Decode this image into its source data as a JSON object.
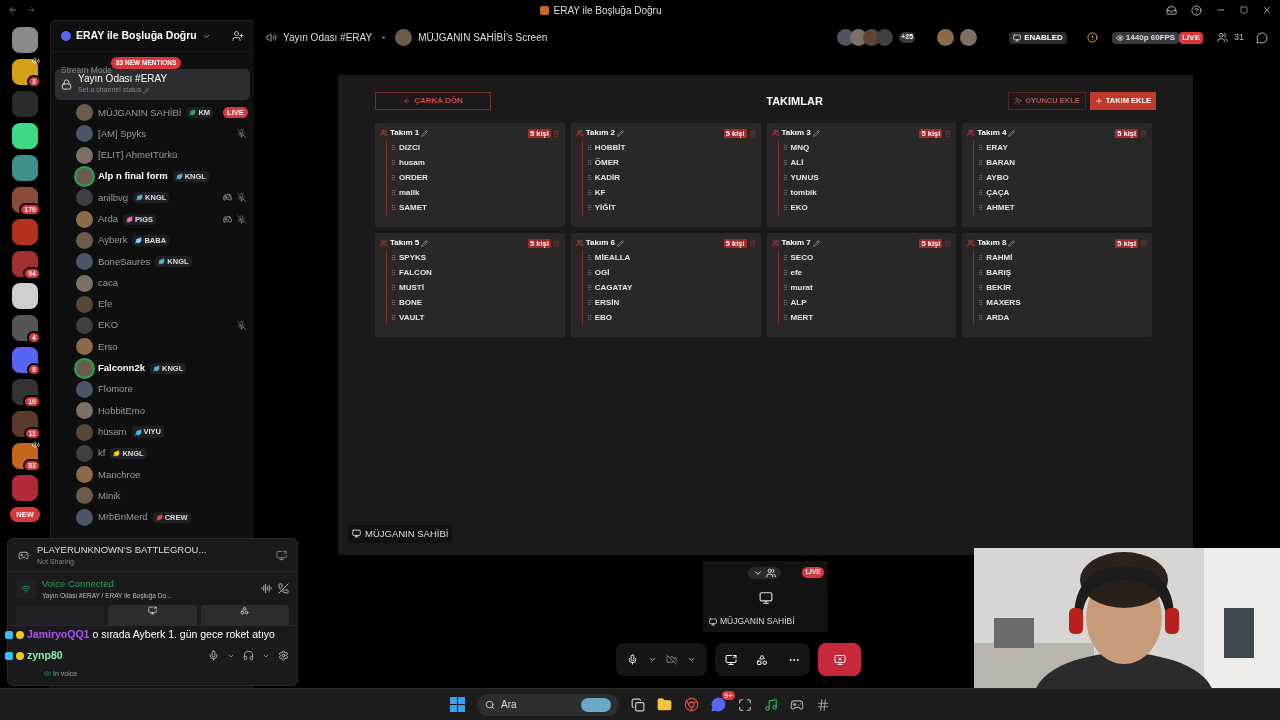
{
  "window": {
    "title": "ERAY ile Boşluğa Doğru"
  },
  "servers": [
    {
      "color": "#8a8a8a"
    },
    {
      "color": "#d4a017",
      "badge": "3",
      "speaking": true
    },
    {
      "color": "#2b2b2b"
    },
    {
      "color": "#3ddc84"
    },
    {
      "color": "#3f8f8a"
    },
    {
      "color": "#8a4b3a",
      "badge": "170"
    },
    {
      "color": "#b3321e"
    },
    {
      "color": "#a33030",
      "badge": "94"
    },
    {
      "color": "#cfcfcf"
    },
    {
      "color": "#555555",
      "badge": "4"
    },
    {
      "color": "#5865f2",
      "badge": "9"
    },
    {
      "color": "#333333",
      "badge": "10"
    },
    {
      "color": "#5a3a2a",
      "badge": "11"
    },
    {
      "color": "#c7661f",
      "badge": "83",
      "speaking": true
    },
    {
      "color": "#b22b3a"
    }
  ],
  "new_pill": "NEW",
  "server": {
    "name": "ERAY ile Boşluğa Doğru"
  },
  "stream_mode": "Stream Mode",
  "mentions": "83 NEW MENTIONS",
  "channel": {
    "name": "Yayın Odası #ERAY",
    "status": "Set a channel status"
  },
  "members": [
    {
      "name": "MÜJGANIN SAHİBİ",
      "tag": {
        "text": "KM",
        "color": "#3ba55d"
      },
      "live": "LIVE",
      "speaking": false,
      "muted": false,
      "activity": false
    },
    {
      "name": "[AM] Spyks",
      "speaking": false,
      "muted": true,
      "activity": false
    },
    {
      "name": "[ELIT] AhmetTürkü",
      "speaking": false,
      "muted": false,
      "activity": false
    },
    {
      "name": "Alp n final form",
      "tag": {
        "text": "KNGL",
        "color": "#4fb3d9"
      },
      "speaking": true,
      "muted": false,
      "activity": false
    },
    {
      "name": "anilbvg",
      "tag": {
        "text": "KNGL",
        "color": "#4fb3d9"
      },
      "speaking": false,
      "muted": true,
      "activity": true
    },
    {
      "name": "Arda",
      "tag": {
        "text": "PIGS",
        "color": "#f472b6"
      },
      "speaking": false,
      "muted": true,
      "activity": true
    },
    {
      "name": "Ayberk",
      "tag": {
        "text": "BABA",
        "color": "#7dd3fc"
      },
      "speaking": false,
      "muted": false,
      "activity": false
    },
    {
      "name": "BoneSaures",
      "tag": {
        "text": "KNGL",
        "color": "#4fb3d9"
      },
      "speaking": false,
      "muted": false,
      "activity": false
    },
    {
      "name": "caca",
      "speaking": false,
      "muted": false,
      "activity": false
    },
    {
      "name": "Efe",
      "speaking": false,
      "muted": false,
      "activity": false
    },
    {
      "name": "EKO",
      "speaking": false,
      "muted": true,
      "activity": false
    },
    {
      "name": "Erso",
      "speaking": false,
      "muted": false,
      "activity": false
    },
    {
      "name": "Falconn2k",
      "tag": {
        "text": "KNGL",
        "color": "#4fb3d9"
      },
      "speaking": true,
      "muted": false,
      "activity": false
    },
    {
      "name": "Flomore",
      "speaking": false,
      "muted": false,
      "activity": false
    },
    {
      "name": "HobbitEmo",
      "speaking": false,
      "muted": false,
      "activity": false
    },
    {
      "name": "hüsam",
      "tag": {
        "text": "VIYU",
        "color": "#38bdf8"
      },
      "speaking": false,
      "muted": false,
      "activity": false
    },
    {
      "name": "kf",
      "tag": {
        "text": "KNGL",
        "color": "#facc15"
      },
      "speaking": false,
      "muted": false,
      "activity": false
    },
    {
      "name": "Manchroe",
      "speaking": false,
      "muted": false,
      "activity": false
    },
    {
      "name": "Minik",
      "speaking": false,
      "muted": false,
      "activity": false
    },
    {
      "name": "MrbBnMerd",
      "tag": {
        "text": "CREW",
        "color": "#ef4444"
      },
      "speaking": false,
      "muted": false,
      "activity": false
    }
  ],
  "game": {
    "title": "PLAYERUNKNOWN'S BATTLEGROU...",
    "status": "Not Sharing"
  },
  "voice": {
    "title": "Voice Connected",
    "location": "Yayın Odası #ERAY / ERAY ile Boşluğa Do..."
  },
  "user": {
    "status": "In voice"
  },
  "chat": [
    {
      "user": "JamiryoQQ1",
      "color": "#a855f7",
      "text": "o sırada Ayberk 1. gün gece roket atıyo"
    },
    {
      "user": "zynp80",
      "color": "#86efac"
    }
  ],
  "topbar": {
    "channel": "Yayın Odası #ERAY",
    "stream": "MÜJGANIN SAHİBİ's Screen",
    "more_viewers": "+25",
    "badge": "ENABLED",
    "quality": "1440p 60FPS",
    "live": "LIVE",
    "count": "31"
  },
  "app": {
    "back": "ÇARKA DÖN",
    "title": "TAKIMLAR",
    "add_player": "OYUNCU EKLE",
    "add_team": "TAKIM EKLE",
    "teams": [
      {
        "name": "Takım 1",
        "count": "5 kişi",
        "players": [
          "DIZCI",
          "husam",
          "ORDER",
          "malik",
          "SAMET"
        ]
      },
      {
        "name": "Takım 2",
        "count": "5 kişi",
        "players": [
          "HOBBİT",
          "ÖMER",
          "KADİR",
          "KF",
          "YİĞİT"
        ]
      },
      {
        "name": "Takım 3",
        "count": "5 kişi",
        "players": [
          "MNQ",
          "ALİ",
          "YUNUS",
          "tombik",
          "EKO"
        ]
      },
      {
        "name": "Takım 4",
        "count": "5 kişi",
        "players": [
          "ERAY",
          "BARAN",
          "AYBO",
          "ÇAÇA",
          "AHMET"
        ]
      },
      {
        "name": "Takım 5",
        "count": "5 kişi",
        "players": [
          "SPYKS",
          "FALCON",
          "MUSTİ",
          "BONE",
          "VAULT"
        ]
      },
      {
        "name": "Takım 6",
        "count": "5 kişi",
        "players": [
          "MİEALLA",
          "OGİ",
          "CAGATAY",
          "ERSİN",
          "EBO"
        ]
      },
      {
        "name": "Takım 7",
        "count": "5 kişi",
        "players": [
          "SECO",
          "efe",
          "murat",
          "ALP",
          "MERT"
        ]
      },
      {
        "name": "Takım 8",
        "count": "5 kişi",
        "players": [
          "RAHMİ",
          "BARIŞ",
          "BEKİR",
          "MAXERS",
          "ARDA"
        ]
      }
    ]
  },
  "streamer_label": "MÜJGANIN SAHİBİ",
  "preview": {
    "live": "LIVE",
    "name": "MÜJGANIN SAHİBİ"
  },
  "taskbar": {
    "search": "Ara",
    "discord_badge": "9+"
  }
}
